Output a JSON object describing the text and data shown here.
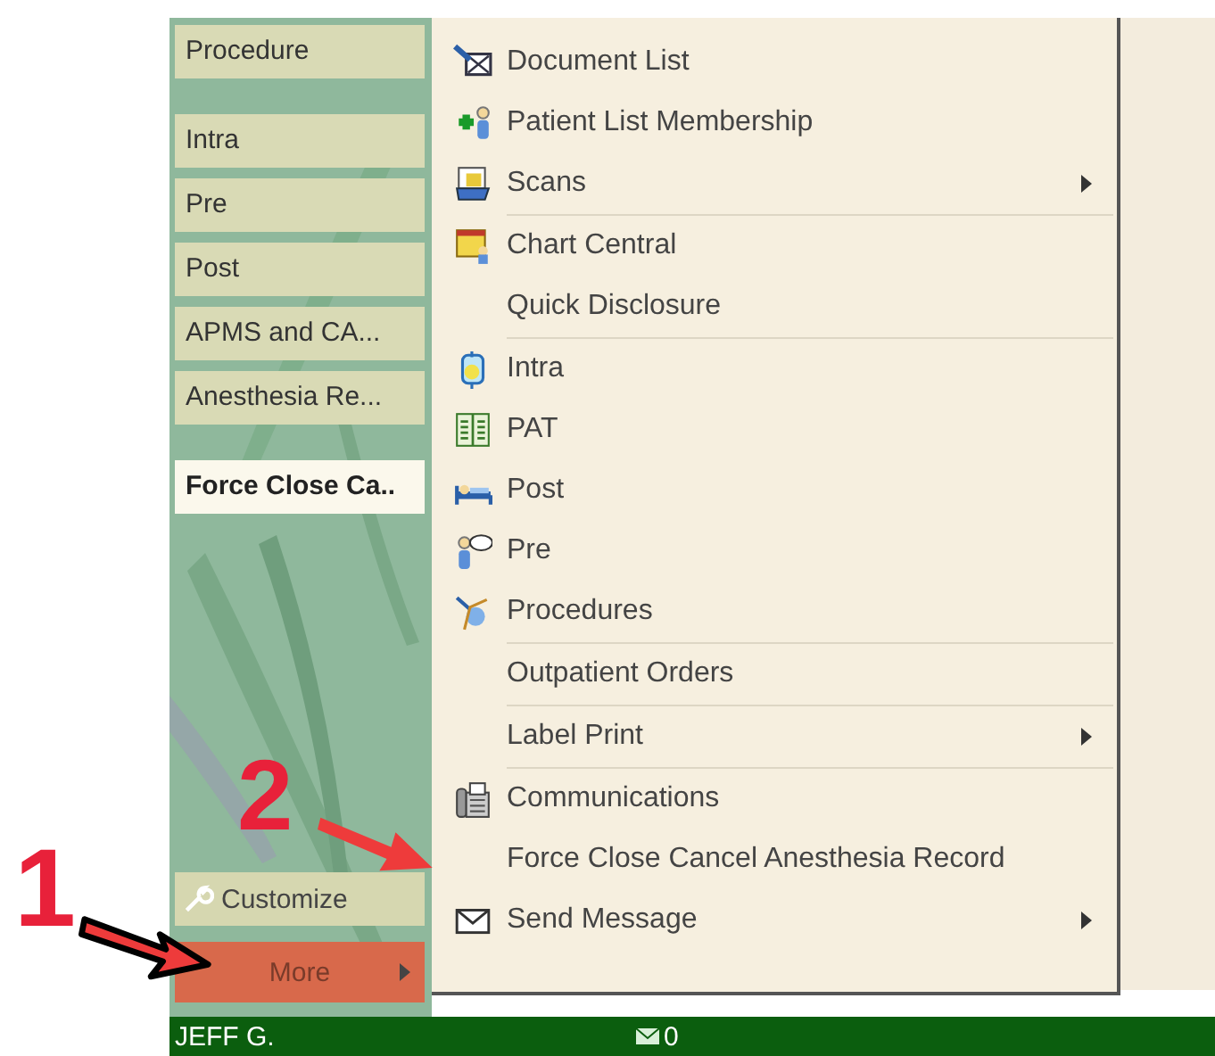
{
  "sidebar": {
    "groups": [
      [
        {
          "label": "Procedure",
          "selected": false
        }
      ],
      [
        {
          "label": "Intra",
          "selected": false
        },
        {
          "label": "Pre",
          "selected": false
        },
        {
          "label": "Post",
          "selected": false
        },
        {
          "label": "APMS and CA...",
          "selected": false
        },
        {
          "label": "Anesthesia Re...",
          "selected": false
        }
      ],
      [
        {
          "label": "Force Close Ca..",
          "selected": true
        }
      ]
    ],
    "customize": "Customize",
    "more": "More"
  },
  "menu": {
    "groups": [
      [
        {
          "label": "Document List",
          "submenu": false
        },
        {
          "label": "Patient List Membership",
          "submenu": false
        },
        {
          "label": "Scans",
          "submenu": true
        }
      ],
      [
        {
          "label": "Chart Central",
          "submenu": false
        },
        {
          "label": "Quick Disclosure",
          "submenu": false
        }
      ],
      [
        {
          "label": "Intra",
          "submenu": false
        },
        {
          "label": "PAT",
          "submenu": false
        },
        {
          "label": "Post",
          "submenu": false
        },
        {
          "label": "Pre",
          "submenu": false
        },
        {
          "label": "Procedures",
          "submenu": false
        }
      ],
      [
        {
          "label": "Outpatient Orders",
          "submenu": false
        }
      ],
      [
        {
          "label": "Label Print",
          "submenu": true
        }
      ],
      [
        {
          "label": "Communications",
          "submenu": false
        },
        {
          "label": "Force Close Cancel Anesthesia Record",
          "submenu": false
        },
        {
          "label": "Send Message",
          "submenu": true
        }
      ]
    ]
  },
  "annotations": [
    "1",
    "2"
  ],
  "status_bar": {
    "user": "JEFF G.",
    "messages": "0"
  }
}
